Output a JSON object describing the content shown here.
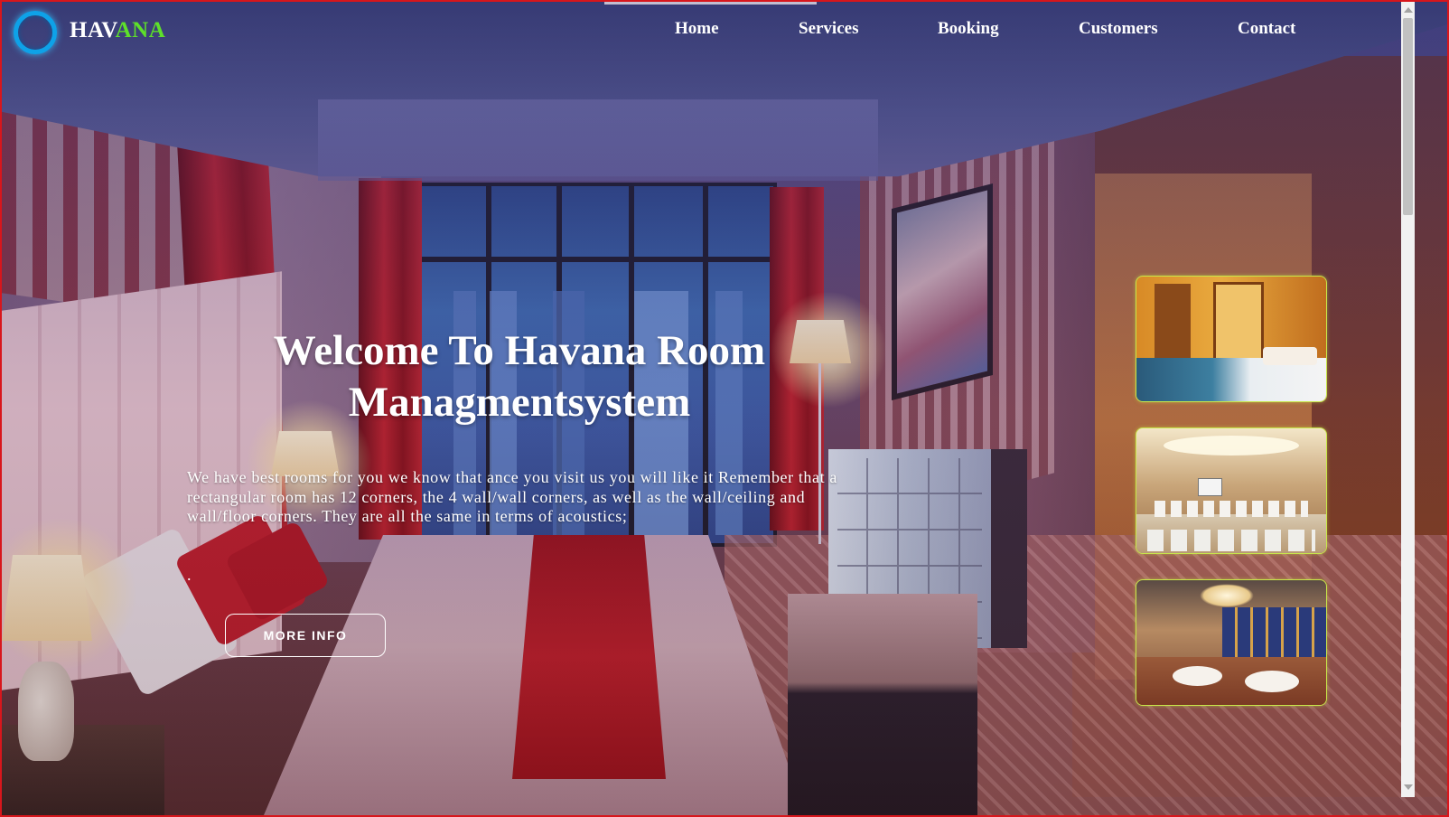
{
  "brand": {
    "part1": "HAV",
    "part2": "ANA",
    "accent_color": "#5ee02a",
    "ring_color": "#0ea2e8"
  },
  "nav": {
    "items": [
      "Home",
      "Services",
      "Booking",
      "Customers",
      "Contact"
    ]
  },
  "hero": {
    "title_line1": "Welcome To Havana Room",
    "title_line2": "Managmentsystem",
    "paragraph": "We have best rooms for you we know that ance you visit us you will like it Remember that a rectangular room has 12 corners, the 4 wall/wall corners, as well as the wall/ceiling and wall/floor corners. They are all the same in terms of acoustics;",
    "dot": ".",
    "button_label": "MORE INFO"
  },
  "thumbnails": [
    {
      "subject": "hotel-bedroom-photo"
    },
    {
      "subject": "conference-room-photo"
    },
    {
      "subject": "restaurant-photo"
    }
  ],
  "frame_color": "#d8161c"
}
